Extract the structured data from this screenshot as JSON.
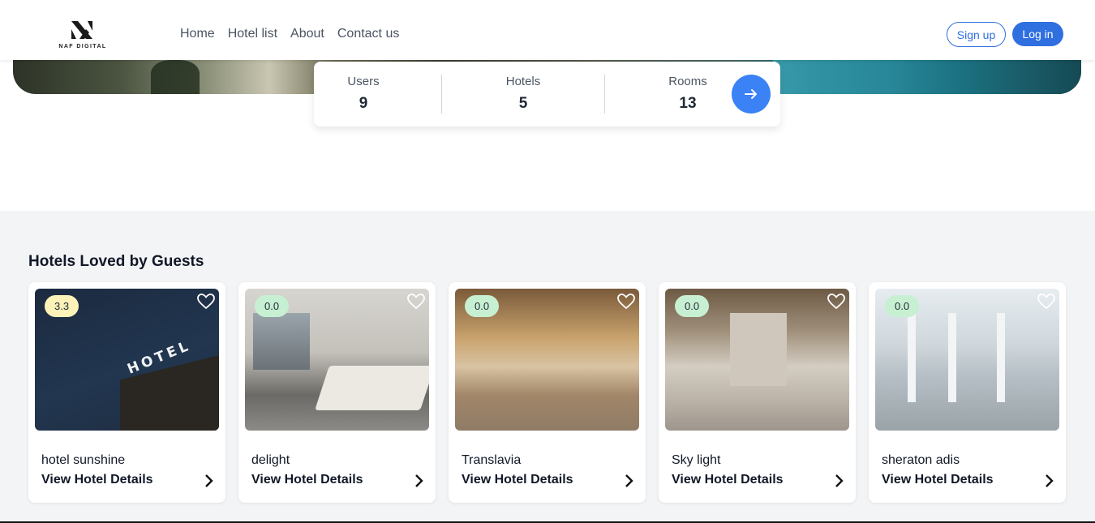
{
  "brand": {
    "logo_text": "NAF DIGITAL"
  },
  "nav": {
    "items": [
      "Home",
      "Hotel list",
      "About",
      "Contact us"
    ]
  },
  "auth": {
    "signup_label": "Sign up",
    "login_label": "Log in"
  },
  "stats": [
    {
      "label": "Users",
      "value": "9"
    },
    {
      "label": "Hotels",
      "value": "5"
    },
    {
      "label": "Rooms",
      "value": "13"
    }
  ],
  "section": {
    "title": "Hotels Loved by Guests"
  },
  "hotels": [
    {
      "name": "hotel sunshine",
      "rating": "3.3",
      "rating_color": "#fdf2b8",
      "details_label": "View Hotel Details"
    },
    {
      "name": "delight",
      "rating": "0.0",
      "rating_color": "#c7f0d2",
      "details_label": "View Hotel Details"
    },
    {
      "name": "Translavia",
      "rating": "0.0",
      "rating_color": "#c7f0d2",
      "details_label": "View Hotel Details"
    },
    {
      "name": "Sky light",
      "rating": "0.0",
      "rating_color": "#c7f0d2",
      "details_label": "View Hotel Details"
    },
    {
      "name": "sheraton adis",
      "rating": "0.0",
      "rating_color": "#c7f0d2",
      "details_label": "View Hotel Details"
    }
  ],
  "images": {
    "hotel_sign_text": "HOTEL"
  },
  "colors": {
    "primary": "#2f6fe0",
    "accent": "#3b82f6",
    "section_bg": "#f3f4f6"
  },
  "icons": {
    "favorite": "heart-icon",
    "next": "chevron-right-icon",
    "go": "arrow-right-icon"
  }
}
